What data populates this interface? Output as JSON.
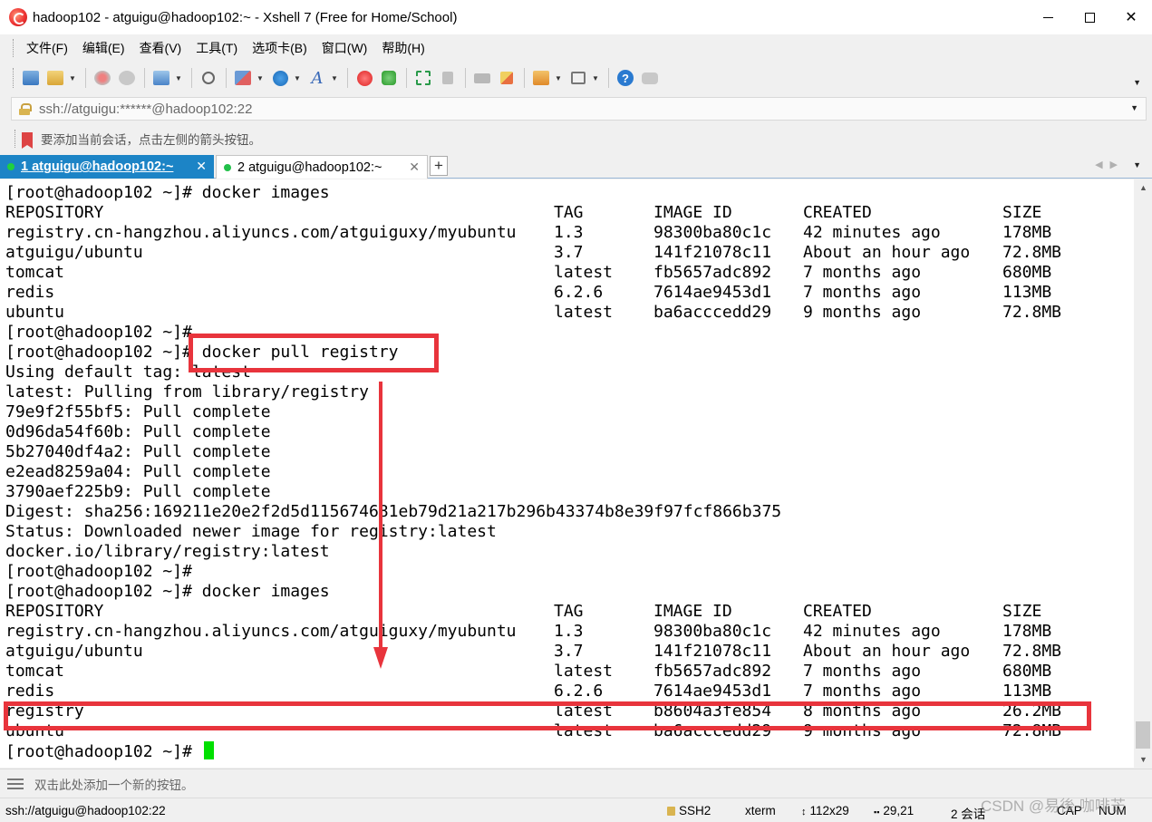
{
  "window": {
    "title": "hadoop102 - atguigu@hadoop102:~ - Xshell 7 (Free for Home/School)"
  },
  "menu": [
    "文件(F)",
    "编辑(E)",
    "查看(V)",
    "工具(T)",
    "选项卡(B)",
    "窗口(W)",
    "帮助(H)"
  ],
  "toolbar": {
    "buttons": [
      "new-session",
      "open-folder",
      "disconnect",
      "reconnect",
      "properties",
      "find",
      "transfer",
      "globe",
      "font",
      "xshell",
      "xftp",
      "fullscreen",
      "lock",
      "keyboard",
      "highlight",
      "compose",
      "layout",
      "help",
      "chat"
    ]
  },
  "address": {
    "value": "ssh://atguigu:******@hadoop102:22"
  },
  "infobar": {
    "text": "要添加当前会话，点击左侧的箭头按钮。"
  },
  "tabs": [
    {
      "label": "1 atguigu@hadoop102:~",
      "active": true
    },
    {
      "label": "2 atguigu@hadoop102:~",
      "active": false
    }
  ],
  "terminal": {
    "lines": [
      [
        "[root@hadoop102 ~]# docker images"
      ],
      [
        "REPOSITORY",
        "TAG",
        "IMAGE ID",
        "CREATED",
        "SIZE"
      ],
      [
        "registry.cn-hangzhou.aliyuncs.com/atguiguxy/myubuntu",
        "1.3",
        "98300ba80c1c",
        "42 minutes ago",
        "178MB"
      ],
      [
        "atguigu/ubuntu",
        "3.7",
        "141f21078c11",
        "About an hour ago",
        "72.8MB"
      ],
      [
        "tomcat",
        "latest",
        "fb5657adc892",
        "7 months ago",
        "680MB"
      ],
      [
        "redis",
        "6.2.6",
        "7614ae9453d1",
        "7 months ago",
        "113MB"
      ],
      [
        "ubuntu",
        "latest",
        "ba6acccedd29",
        "9 months ago",
        "72.8MB"
      ],
      [
        "[root@hadoop102 ~]#"
      ],
      [
        "[root@hadoop102 ~]# docker pull registry"
      ],
      [
        "Using default tag: latest"
      ],
      [
        "latest: Pulling from library/registry"
      ],
      [
        "79e9f2f55bf5: Pull complete"
      ],
      [
        "0d96da54f60b: Pull complete"
      ],
      [
        "5b27040df4a2: Pull complete"
      ],
      [
        "e2ead8259a04: Pull complete"
      ],
      [
        "3790aef225b9: Pull complete"
      ],
      [
        "Digest: sha256:169211e20e2f2d5d115674681eb79d21a217b296b43374b8e39f97fcf866b375"
      ],
      [
        "Status: Downloaded newer image for registry:latest"
      ],
      [
        "docker.io/library/registry:latest"
      ],
      [
        "[root@hadoop102 ~]#"
      ],
      [
        "[root@hadoop102 ~]# docker images"
      ],
      [
        "REPOSITORY",
        "TAG",
        "IMAGE ID",
        "CREATED",
        "SIZE"
      ],
      [
        "registry.cn-hangzhou.aliyuncs.com/atguiguxy/myubuntu",
        "1.3",
        "98300ba80c1c",
        "42 minutes ago",
        "178MB"
      ],
      [
        "atguigu/ubuntu",
        "3.7",
        "141f21078c11",
        "About an hour ago",
        "72.8MB"
      ],
      [
        "tomcat",
        "latest",
        "fb5657adc892",
        "7 months ago",
        "680MB"
      ],
      [
        "redis",
        "6.2.6",
        "7614ae9453d1",
        "7 months ago",
        "113MB"
      ],
      [
        "registry",
        "latest",
        "b8604a3fe854",
        "8 months ago",
        "26.2MB"
      ],
      [
        "ubuntu",
        "latest",
        "ba6acccedd29",
        "9 months ago",
        "72.8MB"
      ],
      [
        "[root@hadoop102 ~]# "
      ]
    ]
  },
  "quickbar": {
    "text": "双击此处添加一个新的按钮。"
  },
  "status": {
    "connection": "ssh://atguigu@hadoop102:22",
    "protocol": "SSH2",
    "terminal_type": "xterm",
    "size": "112x29",
    "position": "29,21",
    "sessions": "2 会话",
    "cap": "CAP",
    "num": "NUM"
  },
  "watermark": "CSDN @易後 咖啡芒",
  "colors": {
    "active_tab": "#1c84c6",
    "annotation": "#e8343c",
    "cursor": "#00e000"
  }
}
